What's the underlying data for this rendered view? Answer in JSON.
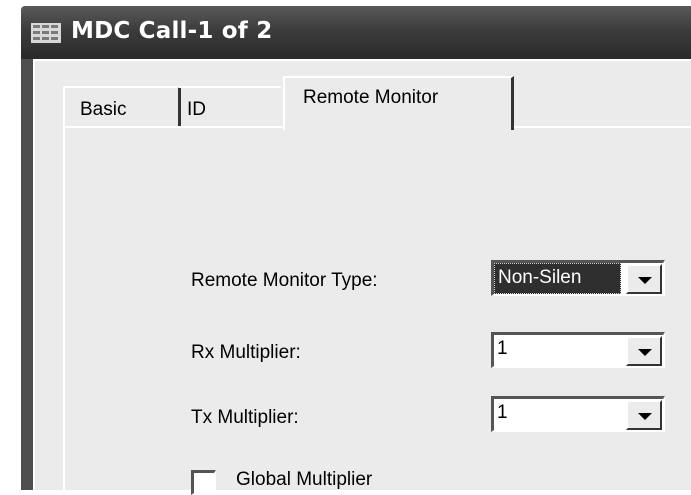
{
  "window": {
    "title": "MDC Call-1 of 2",
    "icon": "grid-app-icon"
  },
  "tabs": [
    {
      "label": "Basic",
      "active": false
    },
    {
      "label": "ID",
      "active": false
    },
    {
      "label": "Remote Monitor",
      "active": true
    }
  ],
  "form": {
    "remote_monitor_type": {
      "label": "Remote Monitor Type:",
      "value": "Non-Silen"
    },
    "rx_multiplier": {
      "label": "Rx Multiplier:",
      "value": "1"
    },
    "tx_multiplier": {
      "label": "Tx Multiplier:",
      "value": "1"
    },
    "global_multiplier": {
      "label": "Global Multiplier",
      "checked": false
    }
  },
  "colors": {
    "titlebar": "#3c3c3c",
    "window_bg": "#ebebeb",
    "selected_bg": "#2f2f2f"
  }
}
